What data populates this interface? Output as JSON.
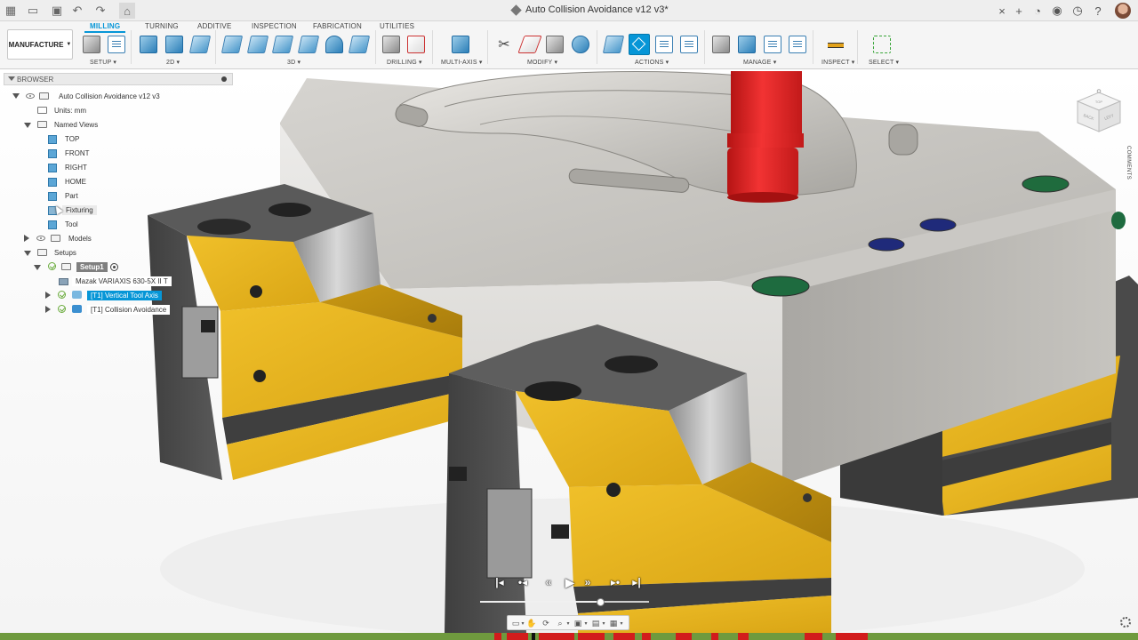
{
  "document": {
    "title": "Auto Collision Avoidance v12 v3*"
  },
  "ribbon": {
    "workspace": "MANUFACTURE",
    "tabs": [
      "MILLING",
      "TURNING",
      "ADDITIVE",
      "INSPECTION",
      "FABRICATION",
      "UTILITIES"
    ],
    "active_tab": "MILLING",
    "groups": [
      "SETUP",
      "2D",
      "3D",
      "DRILLING",
      "MULTI-AXIS",
      "MODIFY",
      "ACTIONS",
      "MANAGE",
      "INSPECT",
      "SELECT"
    ]
  },
  "browser": {
    "title": "BROWSER",
    "root": "Auto Collision Avoidance v12 v3",
    "units": "Units: mm",
    "named_views_label": "Named Views",
    "named_views": [
      "TOP",
      "FRONT",
      "RIGHT",
      "HOME",
      "Part",
      "Fixturing",
      "Tool"
    ],
    "models_label": "Models",
    "setups_label": "Setups",
    "setup": "Setup1",
    "machine": "Mazak VARIAXIS 630-5X II T",
    "operations": [
      "[T1] Vertical Tool Axis",
      "[T1] Collision Avoidance"
    ]
  },
  "viewcube": {
    "top": "TOP",
    "front": "BACK",
    "right": "LEFT"
  },
  "comments_label": "COMMENTS",
  "colors": {
    "accent": "#0696d7",
    "fixture_yellow": "#e7b420",
    "tool_red": "#dd2222",
    "timeline_green": "#6f9a3e",
    "timeline_red": "#d21c1c"
  },
  "icons": {
    "playback": [
      "skip-to-start-icon",
      "previous-step-icon",
      "rewind-icon",
      "play-icon",
      "fast-forward-icon",
      "next-step-icon",
      "skip-to-end-icon"
    ],
    "navbar": [
      "display-settings-icon",
      "pan-icon",
      "orbit-icon",
      "zoom-icon",
      "visual-style-icon",
      "grid-icon",
      "viewports-icon"
    ]
  }
}
